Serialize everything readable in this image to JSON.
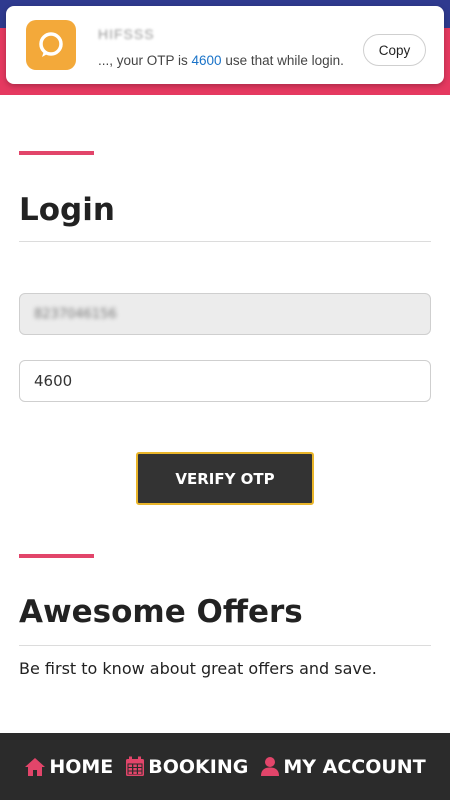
{
  "notification": {
    "sender": "HIFSSS",
    "message_prefix": "..., your OTP is ",
    "otp": "4600",
    "message_suffix": " use that while login.",
    "copy_label": "Copy",
    "icon": "chat-bubble-icon"
  },
  "login": {
    "title": "Login",
    "phone_value": "8237046156",
    "otp_value": "4600",
    "verify_label": "VERIFY OTP"
  },
  "offers": {
    "title": "Awesome Offers",
    "text": "Be first to know about great offers and save."
  },
  "nav": {
    "items": [
      {
        "label": "HOME",
        "icon": "home-icon"
      },
      {
        "label": "BOOKING",
        "icon": "calendar-icon"
      },
      {
        "label": "MY ACCOUNT",
        "icon": "user-icon"
      }
    ]
  },
  "colors": {
    "accent": "#e2456a",
    "button_border": "#e9b52a",
    "nav_bg": "#2b2b2b",
    "notification_icon": "#f3a93a",
    "otp_link": "#1a73c8"
  }
}
